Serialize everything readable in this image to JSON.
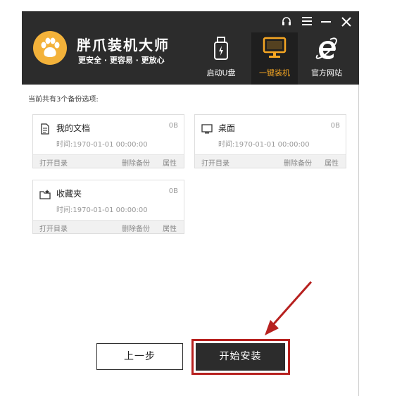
{
  "app": {
    "title": "胖爪装机大师",
    "slogan": "更安全 · 更容易 · 更放心"
  },
  "window_controls": {
    "support": "headset-icon",
    "menu": "menu-icon",
    "minimize": "minimize-icon",
    "close": "close-icon"
  },
  "nav": {
    "items": [
      {
        "label": "启动U盘",
        "icon": "usb-icon",
        "active": false
      },
      {
        "label": "一键装机",
        "icon": "monitor-icon",
        "active": true
      },
      {
        "label": "官方网站",
        "icon": "ie-icon",
        "active": false
      }
    ]
  },
  "colors": {
    "header_bg": "#2c2c2c",
    "accent": "#f5a623",
    "highlight_frame": "#b7211f",
    "logo": "#f3b23a"
  },
  "content": {
    "summary": "当前共有3个备份选项:"
  },
  "backups": [
    {
      "name": "我的文档",
      "size": "0B",
      "time": "时间:1970-01-01 00:00:00",
      "icon": "document-icon",
      "open": "打开目录",
      "delete": "删除备份",
      "props": "属性"
    },
    {
      "name": "桌面",
      "size": "0B",
      "time": "时间:1970-01-01 00:00:00",
      "icon": "desktop-icon",
      "open": "打开目录",
      "delete": "删除备份",
      "props": "属性"
    },
    {
      "name": "收藏夹",
      "size": "0B",
      "time": "时间:1970-01-01 00:00:00",
      "icon": "favorites-folder-icon",
      "open": "打开目录",
      "delete": "删除备份",
      "props": "属性"
    }
  ],
  "actions": {
    "prev": "上一步",
    "start": "开始安装"
  }
}
